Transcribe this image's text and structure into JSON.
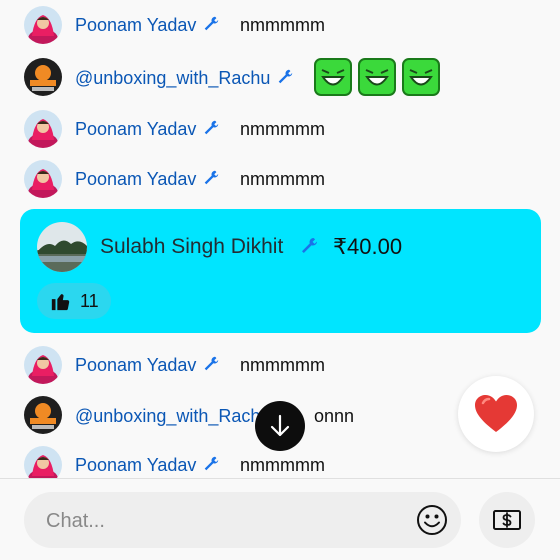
{
  "messages": [
    {
      "author": "Poonam Yadav",
      "text": "nmmmmm",
      "avatar": "poonam"
    },
    {
      "author": "@unboxing_with_Rachu",
      "text": "",
      "emojis": [
        "laughing-green-emoji",
        "laughing-green-emoji",
        "laughing-green-emoji"
      ],
      "avatar": "rachu"
    },
    {
      "author": "Poonam Yadav",
      "text": "nmmmmm",
      "avatar": "poonam"
    },
    {
      "author": "Poonam Yadav",
      "text": "nmmmmm",
      "avatar": "poonam"
    },
    {
      "author": "Poonam Yadav",
      "text": "nmmmmm",
      "avatar": "poonam"
    },
    {
      "author": "@unboxing_with_Rachu",
      "text": "onnn",
      "avatar": "rachu"
    },
    {
      "author": "Poonam Yadav",
      "text": "nmmmmm",
      "avatar": "poonam"
    }
  ],
  "superchat": {
    "author": "Sulabh Singh Dikhit",
    "amount": "₹40.00",
    "likes": "11",
    "color": "#00e5ff"
  },
  "input": {
    "placeholder": "Chat..."
  },
  "icons": {
    "moderator": "wrench-icon",
    "scroll": "arrow-down-icon",
    "reaction": "heart-icon",
    "emoji": "smiley-icon",
    "super_chat": "dollar-bill-icon",
    "like": "thumbs-up-icon"
  },
  "colors": {
    "author_link": "#0b57b5",
    "superchat_bg": "#00e5ff",
    "heart": "#e53935"
  }
}
